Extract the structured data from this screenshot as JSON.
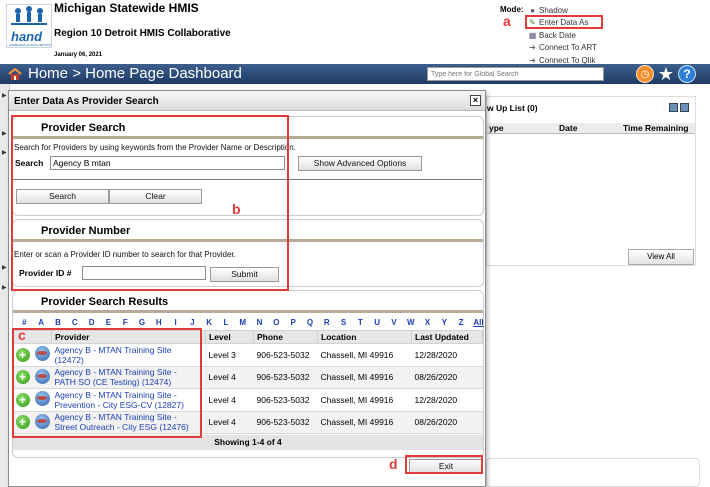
{
  "header": {
    "app_title": "Michigan Statewide HMIS",
    "region": "Region 10 Detroit HMIS Collaborative",
    "date": "January 06, 2021",
    "logo_text": "hand",
    "logo_subtext": "HOMELESS ACTION NETWORK OF DETROIT",
    "mode_label": "Mode:",
    "mode_items": [
      "Shadow",
      "Enter Data As",
      "Back Date",
      "Connect To ART",
      "Connect To Qlik"
    ]
  },
  "navbar": {
    "home": "Home",
    "separator": ">",
    "page": "Home Page Dashboard",
    "search_placeholder": "Type here for Global Search"
  },
  "dashboard": {
    "followup_title": "w Up List (0)",
    "columns": [
      "ype",
      "Date",
      "Time Remaining"
    ],
    "view_all": "View All"
  },
  "modal": {
    "title": "Enter Data As Provider Search",
    "provider_search": {
      "heading": "Provider Search",
      "hint": "Search for Providers by using keywords from the Provider Name or Description.",
      "search_label": "Search",
      "search_value": "Agency B mtan",
      "advanced_button": "Show Advanced Options",
      "search_button": "Search",
      "clear_button": "Clear"
    },
    "provider_number": {
      "heading": "Provider Number",
      "hint": "Enter or scan a Provider ID number to search for that Provider.",
      "id_label": "Provider ID #",
      "submit_button": "Submit"
    },
    "results": {
      "heading": "Provider Search Results",
      "alphabet": [
        "#",
        "A",
        "B",
        "C",
        "D",
        "E",
        "F",
        "G",
        "H",
        "I",
        "J",
        "K",
        "L",
        "M",
        "N",
        "O",
        "P",
        "Q",
        "R",
        "S",
        "T",
        "U",
        "V",
        "W",
        "X",
        "Y",
        "Z"
      ],
      "all_link": "All",
      "columns": [
        "Provider",
        "Level",
        "Phone",
        "Location",
        "Last Updated"
      ],
      "rows": [
        {
          "provider_line1": "Agency B - MTAN Training Site",
          "provider_line2": "(12472)",
          "level": "Level 3",
          "phone": "906-523-5032",
          "location": "Chassell, MI 49916",
          "updated": "12/28/2020"
        },
        {
          "provider_line1": "Agency B - MTAN Training Site -",
          "provider_line2": "PATH SO (CE Testing) (12474)",
          "level": "Level 4",
          "phone": "906-523-5032",
          "location": "Chassell, MI 49916",
          "updated": "08/26/2020"
        },
        {
          "provider_line1": "Agency B - MTAN Training Site -",
          "provider_line2": "Prevention - City ESG-CV (12827)",
          "level": "Level 4",
          "phone": "906-523-5032",
          "location": "Chassell, MI 49916",
          "updated": "12/28/2020"
        },
        {
          "provider_line1": "Agency B - MTAN Training Site -",
          "provider_line2": "Street Outreach - City ESG (12476)",
          "level": "Level 4",
          "phone": "906-523-5032",
          "location": "Chassell, MI 49916",
          "updated": "08/26/2020"
        }
      ],
      "showing": "Showing 1-4 of 4"
    },
    "exit_button": "Exit"
  },
  "annotations": {
    "a": "a",
    "b": "b",
    "c": "c",
    "d": "d",
    "color": "#e23a3a"
  }
}
